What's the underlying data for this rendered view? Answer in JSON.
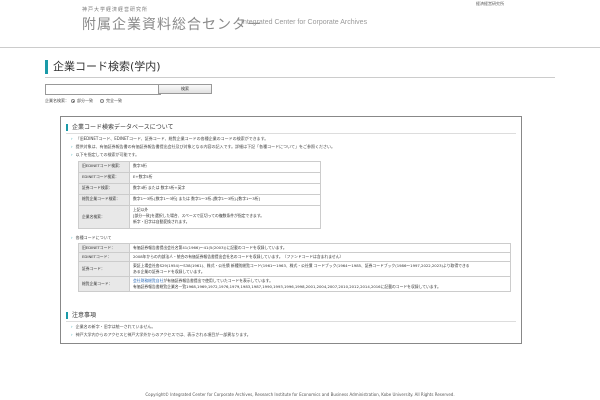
{
  "top_link": "経済経営研究所",
  "header": {
    "institution": "神戸大学経済経営研究所",
    "title": "附属企業資料総合センター",
    "title_en": "Integrated Center for Corporate Archives"
  },
  "page": {
    "title": "企業コード検索(学内)"
  },
  "search": {
    "input_value": "",
    "button_label": "検索",
    "mode_label": "企業名検索：",
    "options": [
      {
        "label": "部分一致",
        "selected": true
      },
      {
        "label": "完全一致",
        "selected": false
      }
    ]
  },
  "about": {
    "heading": "企業コード検索データベースについて",
    "bullets": [
      "『旧EDINETコード、EDINETコード、証券コード、総覧企業コードの各種企業のコードの検索ができます。",
      "提供対象は、有価証券報告書の有価証券報告書提出会社及び対象となる内容の記入です。詳細は下記「各種コードについて」をご参照ください。",
      "以下を指定しての検索が可能です。"
    ],
    "search_fields": [
      {
        "name": "旧EDINETコード検索：",
        "value": "数字5桁"
      },
      {
        "name": "EDINETコード検索：",
        "value": "E+数字5桁"
      },
      {
        "name": "証券コード検索：",
        "value": "数字4桁 または 数字3桁+英字"
      },
      {
        "name": "総覧企業コード検索：",
        "value": "数字1～3桁-[数字1～3桁] または 数字1～3桁-[数字1～3桁]-[数字1～3桁]"
      },
      {
        "name": "企業名検索：",
        "lines": [
          "上記以外",
          "[部分一致]を選択した場合、スペースで区切っての複数条件が指定できます。",
          "新字・旧字は自動変換されます。"
        ]
      }
    ]
  },
  "codes": {
    "heading": "各種コードについて",
    "rows": [
      {
        "name": "旧EDINETコード：",
        "lines": [
          "有価証券報告書提出会社名第41(1966)～41(5(2003))に記載のコードを収録しています。"
        ]
      },
      {
        "name": "EDINETコード：",
        "lines": [
          "2008年からの内部法人・統合の有価証券報告書提出会社名のコードを収録しています。（ファンドコードは含まれません）"
        ]
      },
      {
        "name": "証券コード：",
        "lines": [
          "東証上場会社各S29(1954)～S38(1961)、株式・公社債 新種別総覧コード(1961～1963、株式・公社債 コードブック(1964～1985、証券コードブック(1986～1997,2022,2023)より取得できる",
          "ある企業の証券コードを収録しています。"
        ]
      },
      {
        "name": "総覧企業コード：",
        "link": "会社財務総覧自社",
        "lines": [
          "が有価証券報告書提出で使用していたコードを表示しています。",
          "有価証券報告書総覧企業名一覧1968,1969,1972,1976,1979,1983,1987,1990,1993,1996,1998,2001,2004,2007,2010,2012,2014,2016に記載のコードを収録しています。"
        ]
      }
    ]
  },
  "notes": {
    "heading": "注意事項",
    "bullets": [
      "企業名の新字・旧字は統一されていません。",
      "神戸大学内からのアクセスと神戸大学外からのアクセスでは、表示される項目が一部異なります。"
    ]
  },
  "footer": "Copyright© Integrated Center for Corporate Archives, Research Institute for Economics and Business Administration, Kobe University. All Rights Reserved."
}
